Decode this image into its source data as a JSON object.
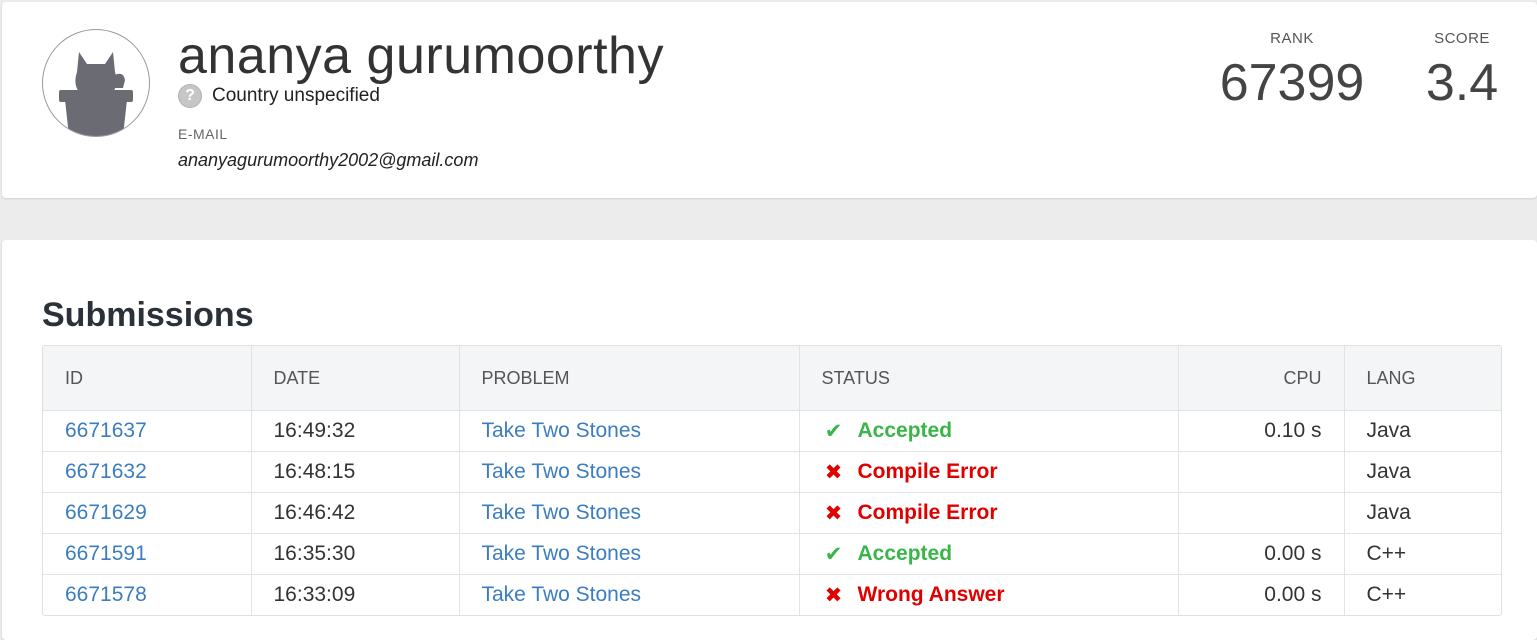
{
  "profile": {
    "name": "ananya gurumoorthy",
    "country": "Country unspecified",
    "country_icon": "question-icon",
    "email_label": "E-MAIL",
    "email": "ananyagurumoorthy2002@gmail.com",
    "rank_label": "RANK",
    "rank": "67399",
    "score_label": "SCORE",
    "score": "3.4"
  },
  "submissions": {
    "title": "Submissions",
    "columns": [
      "ID",
      "DATE",
      "PROBLEM",
      "STATUS",
      "CPU",
      "LANG"
    ],
    "rows": [
      {
        "id": "6671637",
        "date": "16:49:32",
        "problem": "Take Two Stones",
        "status": "Accepted",
        "status_type": "ok",
        "status_icon": "check-icon",
        "cpu": "0.10 s",
        "lang": "Java"
      },
      {
        "id": "6671632",
        "date": "16:48:15",
        "problem": "Take Two Stones",
        "status": "Compile Error",
        "status_type": "err",
        "status_icon": "cross-icon",
        "cpu": "",
        "lang": "Java"
      },
      {
        "id": "6671629",
        "date": "16:46:42",
        "problem": "Take Two Stones",
        "status": "Compile Error",
        "status_type": "err",
        "status_icon": "cross-icon",
        "cpu": "",
        "lang": "Java"
      },
      {
        "id": "6671591",
        "date": "16:35:30",
        "problem": "Take Two Stones",
        "status": "Accepted",
        "status_type": "ok",
        "status_icon": "check-icon",
        "cpu": "0.00 s",
        "lang": "C++"
      },
      {
        "id": "6671578",
        "date": "16:33:09",
        "problem": "Take Two Stones",
        "status": "Wrong Answer",
        "status_type": "err",
        "status_icon": "cross-icon",
        "cpu": "0.00 s",
        "lang": "C++"
      }
    ]
  },
  "colors": {
    "accepted": "#3bb54a",
    "error": "#e00000",
    "link": "#3b7dbf"
  }
}
